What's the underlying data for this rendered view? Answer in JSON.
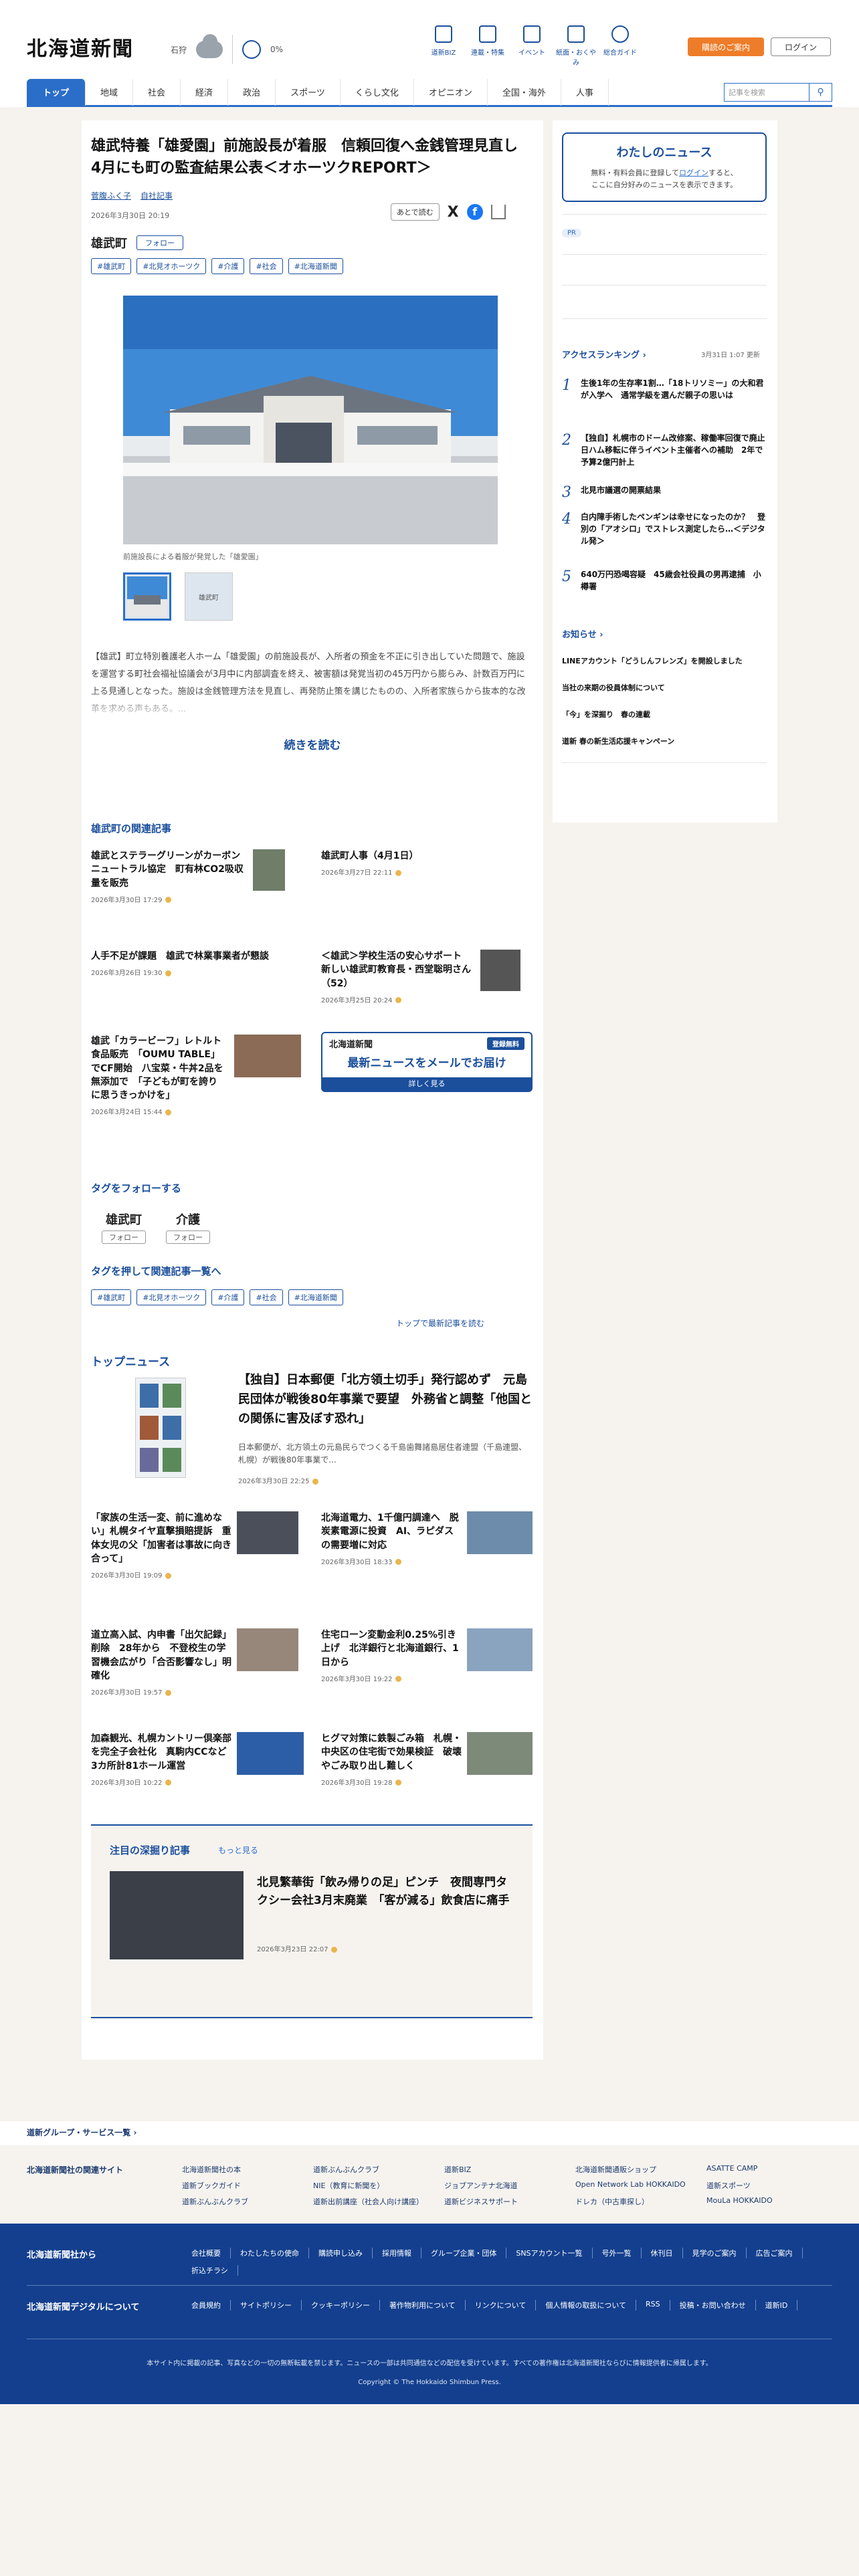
{
  "header": {
    "logo": "北海道新聞",
    "region": "石狩",
    "rain": "0%",
    "nav_icons": [
      {
        "label": "道新BIZ",
        "icon": "bag-icon"
      },
      {
        "label": "連載・特集",
        "icon": "flag-icon"
      },
      {
        "label": "イベント",
        "icon": "calendar-icon"
      },
      {
        "label": "紙面・おくやみ",
        "icon": "newspaper-icon"
      },
      {
        "label": "総合ガイド",
        "icon": "help-icon"
      }
    ],
    "subscribe": "購読のご案内",
    "login": "ログイン"
  },
  "gnav": {
    "items": [
      "トップ",
      "地域",
      "社会",
      "経済",
      "政治",
      "スポーツ",
      "くらし文化",
      "オピニオン",
      "全国・海外",
      "人事"
    ],
    "search_placeholder": "記事を検索"
  },
  "article": {
    "title": "雄武特養「雄愛園」前施設長が着服　信頼回復へ金銭管理見直し　4月にも町の監査結果公表＜オホーツクREPORT＞",
    "author": "菅腹ふく子",
    "author_link": "自社記事",
    "date": "2026年3月30日 20:19",
    "read_later": "あとで読む",
    "town": "雄武町",
    "follow": "フォロー",
    "tags": [
      "#雄武町",
      "#北見オホーツク",
      "#介護",
      "#社会",
      "#北海道新聞"
    ],
    "photo_caption": "前施設長による着服が発覚した「雄愛園」",
    "thumb2": "雄武町",
    "lead": "【雄武】町立特別養護老人ホーム「雄愛園」の前施設長が、入所者の預金を不正に引き出していた問題で、施設を運営する町社会福祉協議会が3月中に内部調査を終え、被害額は発覚当初の45万円から膨らみ、計数百万円に上る見通しとなった。施設は金銭管理方法を見直し、再発防止策を講じたものの、入所者家族らから抜本的な改革を求める声もある。...",
    "read_more": "続きを読む"
  },
  "related": {
    "title": "雄武町の関連記事",
    "items": [
      {
        "title": "雄武とステラーグリーンがカーボンニュートラル協定　町有林CO2吸収量を販売",
        "date": "2026年3月30日 17:29"
      },
      {
        "title": "雄武町人事（4月1日）",
        "date": "2026年3月27日 22:11"
      },
      {
        "title": "人手不足が課題　雄武で林業事業者が懇談",
        "date": "2026年3月26日 19:30"
      },
      {
        "title": "＜雄武＞学校生活の安心サポート　新しい雄武町教育長・西堂聡明さん（52）",
        "date": "2026年3月25日 20:24"
      },
      {
        "title": "雄武「カラービーフ」レトルト食品販売　「OUMU TABLE」でCF開始　八宝菜・牛丼2品を無添加で　「子どもが町を誇りに思うきっかけを」",
        "date": "2026年3月24日 15:44"
      }
    ],
    "mail": {
      "brand": "北海道新聞",
      "free": "登録無料",
      "msg": "最新ニュースをメールでお届け",
      "btn": "詳しく見る"
    }
  },
  "follow_tags": {
    "title": "タグをフォローする",
    "tags": [
      "雄武町",
      "介護"
    ],
    "btn": "フォロー"
  },
  "tag_list": {
    "title": "タグを押して関連記事一覧へ",
    "tags": [
      "#雄武町",
      "#北見オホーツク",
      "#介護",
      "#社会",
      "#北海道新聞"
    ],
    "more": "トップで最新記事を読む"
  },
  "top_news": {
    "title": "トップニュース",
    "main": {
      "title": "【独自】日本郵便「北方領土切手」発行認めず　元島民団体が戦後80年事業で要望　外務省と調整「他国との関係に害及ぼす恐れ」",
      "lead": "日本郵便が、北方領土の元島民らでつくる千島歯舞諸島居住者連盟（千島連盟、札幌）が戦後80年事業で...",
      "date": "2026年3月30日 22:25"
    },
    "items": [
      {
        "title": "「家族の生活一変、前に進めない」札幌タイヤ直撃損賠提訴　重体女児の父「加害者は事故に向き合って」",
        "date": "2026年3月30日 19:09"
      },
      {
        "title": "北海道電力、1千億円調達へ　脱炭素電源に投資　AI、ラピダスの需要増に対応",
        "date": "2026年3月30日 18:33"
      },
      {
        "title": "道立高入試、内申書「出欠記録」削除　28年から　不登校生の学習機会広がり「合否影響なし」明確化",
        "date": "2026年3月30日 19:57"
      },
      {
        "title": "住宅ローン変動金利0.25%引き上げ　北洋銀行と北海道銀行、1日から",
        "date": "2026年3月30日 19:22"
      },
      {
        "title": "加森観光、札幌カントリー倶楽部を完全子会社化　真駒内CCなど3カ所計81ホール運営",
        "date": "2026年3月30日 10:22"
      },
      {
        "title": "ヒグマ対策に鉄製ごみ箱　札幌・中央区の住宅街で効果検証　破壊やごみ取り出し難しく",
        "date": "2026年3月30日 19:28"
      }
    ]
  },
  "deep": {
    "title": "注目の深掘り記事",
    "more": "もっと見る",
    "item": {
      "title": "北見繁華街「飲み帰りの足」ピンチ　夜間専門タクシー会社3月末廃業　「客が減る」飲食店に痛手",
      "date": "2026年3月23日 22:07"
    }
  },
  "sidebar": {
    "mynews": {
      "title": "わたしのニュース",
      "p1": "無料・有料会員に登録して",
      "login": "ログイン",
      "p2": "すると、",
      "p3": "ここに自分好みのニュースを表示できます。"
    },
    "pr": "PR",
    "ranking": {
      "title": "アクセスランキング",
      "date": "3月31日 1:07 更新",
      "items": [
        "生後1年の生存率1割…「18トリソミー」の大和君が入学へ　通常学級を選んだ親子の思いは",
        "【独自】札幌市のドーム改修案、稼働率回復で廃止　日ハム移転に伴うイベント主催者への補助　2年で予算2億円計上",
        "北見市議選の開票結果",
        "白内障手術したペンギンは幸せになったのか？　登別の「アオシロ」でストレス測定したら…＜デジタル発＞",
        "640万円恐喝容疑　45歳会社役員の男再逮捕　小樽署"
      ]
    },
    "notice": {
      "title": "お知らせ",
      "items": [
        "LINEアカウント「どうしんフレンズ」を開設しました",
        "当社の来期の役員体制について",
        "「今」を深掘り　春の連載",
        "道新 春の新生活応援キャンペーン"
      ]
    }
  },
  "footer": {
    "group": "道新グループ・サービス一覧",
    "sites_label": "北海道新聞社の関連サイト",
    "sites": [
      "北海道新聞社の本",
      "道新ぶんぶんクラブ",
      "道新BIZ",
      "北海道新聞通販ショップ",
      "ASATTE CAMP",
      "道新ブックガイド",
      "NIE（教育に新聞を）",
      "ジョブアンテナ北海道",
      "Open Network Lab HOKKAIDO",
      "道新スポーツ",
      "道新ぶんぶんクラブ",
      "道新出前講座（社会人向け講座）",
      "道新ビジネスサポート",
      "ドレカ（中古車探し）",
      "MouLa HOKKAIDO"
    ],
    "company_label": "北海道新聞社から",
    "company_links": [
      "会社概要",
      "わたしたちの使命",
      "購読申し込み",
      "採用情報",
      "グループ企業・団体",
      "SNSアカウント一覧",
      "号外一覧",
      "休刊日",
      "見学のご案内",
      "広告ご案内",
      "折込チラシ"
    ],
    "digital_label": "北海道新聞デジタルについて",
    "digital_links": [
      "会員規約",
      "サイトポリシー",
      "クッキーポリシー",
      "著作物利用について",
      "リンクについて",
      "個人情報の取扱について",
      "RSS",
      "投稿・お問い合わせ",
      "道新ID"
    ],
    "notice": "本サイト内に掲載の記事、写真などの一切の無断転載を禁じます。ニュースの一部は共同通信などの配信を受けています。すべての著作権は北海道新聞社ならびに情報提供者に帰属します。",
    "copyright": "Copyright © The Hokkaido Shimbun Press."
  }
}
